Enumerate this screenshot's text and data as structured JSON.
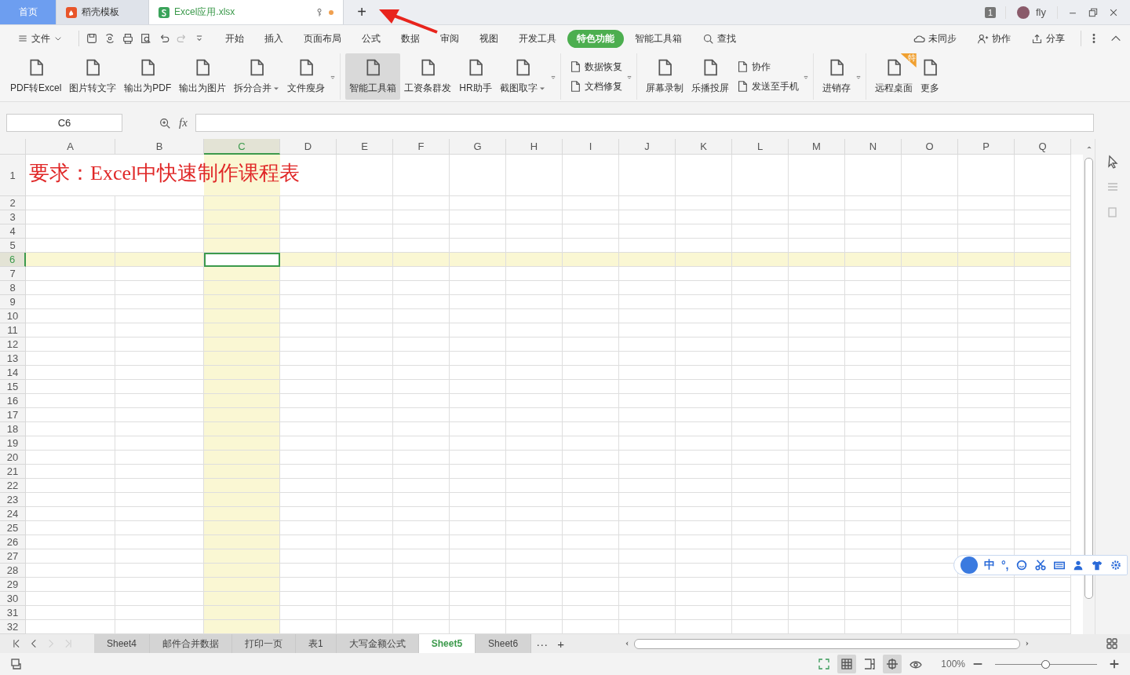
{
  "title_bar": {
    "tabs": [
      {
        "label": "首页",
        "kind": "home",
        "selected": false
      },
      {
        "label": "稻壳模板",
        "kind": "template",
        "selected": false
      },
      {
        "label": "Excel应用.xlsx",
        "kind": "document",
        "selected": true,
        "modified": true
      }
    ],
    "new_tab": "+",
    "window_count": "1",
    "user": "fly"
  },
  "menu_bar": {
    "file": "文件",
    "tabs": [
      {
        "label": "开始",
        "selected": false
      },
      {
        "label": "插入",
        "selected": false
      },
      {
        "label": "页面布局",
        "selected": false
      },
      {
        "label": "公式",
        "selected": false
      },
      {
        "label": "数据",
        "selected": false
      },
      {
        "label": "审阅",
        "selected": false
      },
      {
        "label": "视图",
        "selected": false
      },
      {
        "label": "开发工具",
        "selected": false
      },
      {
        "label": "特色功能",
        "selected": true
      },
      {
        "label": "智能工具箱",
        "selected": false
      }
    ],
    "search": "查找",
    "sync": "未同步",
    "collaborate": "协作",
    "share": "分享"
  },
  "ribbon": [
    {
      "more": true,
      "items": [
        {
          "kind": "large",
          "label": "PDF转Excel"
        },
        {
          "kind": "large",
          "label": "图片转文字"
        },
        {
          "kind": "large",
          "label": "输出为PDF"
        },
        {
          "kind": "large",
          "label": "输出为图片"
        },
        {
          "kind": "large",
          "label": "拆分合并",
          "dropdown": true
        },
        {
          "kind": "large",
          "label": "文件瘦身"
        }
      ]
    },
    {
      "more": true,
      "items": [
        {
          "kind": "large",
          "label": "智能工具箱",
          "selected": true
        },
        {
          "kind": "large",
          "label": "工资条群发"
        },
        {
          "kind": "large",
          "label": "HR助手"
        },
        {
          "kind": "large",
          "label": "截图取字",
          "dropdown": true
        }
      ]
    },
    {
      "more": true,
      "items": [
        {
          "kind": "small",
          "label": "数据恢复"
        },
        {
          "kind": "small",
          "label": "文档修复"
        }
      ]
    },
    {
      "more": true,
      "items": [
        {
          "kind": "large",
          "label": "屏幕录制"
        },
        {
          "kind": "large",
          "label": "乐播投屏"
        },
        {
          "kind": "small",
          "label": "协作"
        },
        {
          "kind": "small",
          "label": "发送至手机"
        }
      ]
    },
    {
      "more": true,
      "items": [
        {
          "kind": "large",
          "label": "进销存"
        }
      ]
    },
    {
      "items": [
        {
          "kind": "large",
          "label": "远程桌面",
          "badge": "特"
        },
        {
          "kind": "large",
          "label": "更多"
        }
      ]
    }
  ],
  "formula_bar": {
    "name_box": "C6",
    "fx": "fx"
  },
  "sheet": {
    "columns": [
      {
        "label": "A",
        "selected": false
      },
      {
        "label": "B",
        "selected": false
      },
      {
        "label": "C",
        "selected": true
      },
      {
        "label": "D",
        "selected": false
      },
      {
        "label": "E",
        "selected": false
      },
      {
        "label": "F",
        "selected": false
      },
      {
        "label": "G",
        "selected": false
      },
      {
        "label": "H",
        "selected": false
      },
      {
        "label": "I",
        "selected": false
      },
      {
        "label": "J",
        "selected": false
      },
      {
        "label": "K",
        "selected": false
      },
      {
        "label": "L",
        "selected": false
      },
      {
        "label": "M",
        "selected": false
      },
      {
        "label": "N",
        "selected": false
      },
      {
        "label": "O",
        "selected": false
      },
      {
        "label": "P",
        "selected": false
      },
      {
        "label": "Q",
        "selected": false
      }
    ],
    "rows": [
      {
        "label": "1",
        "selected": false,
        "cells": [
          "要求：Excel中快速制作课程表"
        ]
      },
      {
        "label": "2",
        "selected": false
      },
      {
        "label": "3",
        "selected": false
      },
      {
        "label": "4",
        "selected": false
      },
      {
        "label": "5",
        "selected": false
      },
      {
        "label": "6",
        "selected": true
      },
      {
        "label": "7",
        "selected": false
      },
      {
        "label": "8",
        "selected": false
      },
      {
        "label": "9",
        "selected": false
      },
      {
        "label": "10",
        "selected": false
      },
      {
        "label": "11",
        "selected": false
      },
      {
        "label": "12",
        "selected": false
      },
      {
        "label": "13",
        "selected": false
      },
      {
        "label": "14",
        "selected": false
      },
      {
        "label": "15",
        "selected": false
      },
      {
        "label": "16",
        "selected": false
      },
      {
        "label": "17",
        "selected": false
      },
      {
        "label": "18",
        "selected": false
      },
      {
        "label": "19",
        "selected": false
      },
      {
        "label": "20",
        "selected": false
      },
      {
        "label": "21",
        "selected": false
      },
      {
        "label": "22",
        "selected": false
      },
      {
        "label": "23",
        "selected": false
      },
      {
        "label": "24",
        "selected": false
      },
      {
        "label": "25",
        "selected": false
      },
      {
        "label": "26",
        "selected": false
      },
      {
        "label": "27",
        "selected": false
      },
      {
        "label": "28",
        "selected": false
      },
      {
        "label": "29",
        "selected": false
      },
      {
        "label": "30",
        "selected": false
      },
      {
        "label": "31",
        "selected": false
      },
      {
        "label": "32",
        "selected": false
      }
    ]
  },
  "sheet_tabs": {
    "tabs": [
      {
        "label": "Sheet4",
        "selected": false
      },
      {
        "label": "邮件合并数据",
        "selected": false
      },
      {
        "label": "打印一页",
        "selected": false
      },
      {
        "label": "表1",
        "selected": false
      },
      {
        "label": "大写金额公式",
        "selected": false
      },
      {
        "label": "Sheet5",
        "selected": true
      },
      {
        "label": "Sheet6",
        "selected": false
      }
    ],
    "more": "···",
    "add": "+"
  },
  "status_bar": {
    "zoom": "100%",
    "zoom_slider": {
      "level": 0.5
    }
  },
  "ime_toolbar": {
    "mode": "中",
    "punctuation": "°,"
  }
}
